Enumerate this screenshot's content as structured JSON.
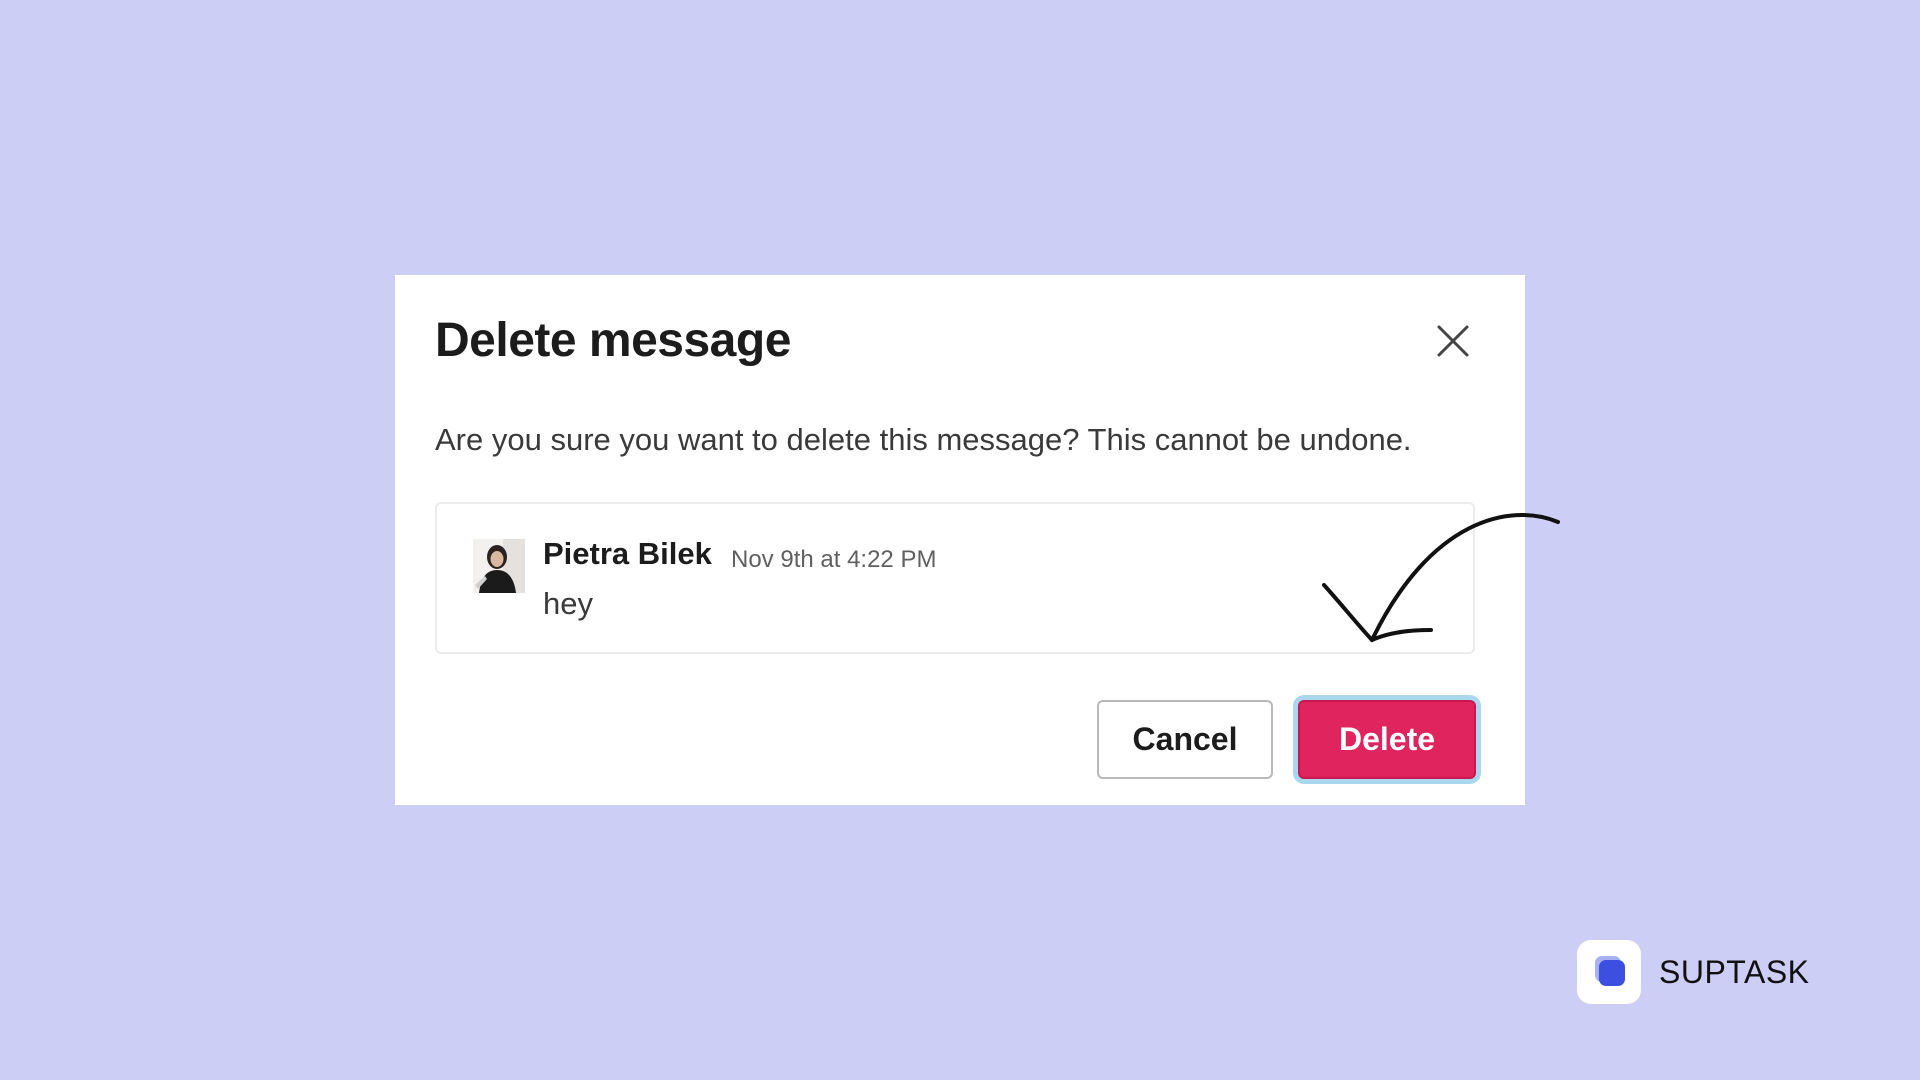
{
  "dialog": {
    "title": "Delete message",
    "description": "Are you sure you want to delete this message? This cannot be undone.",
    "close_icon": "close-icon",
    "message": {
      "author": "Pietra Bilek",
      "timestamp": "Nov 9th at 4:22 PM",
      "text": "hey"
    },
    "cancel_label": "Cancel",
    "delete_label": "Delete"
  },
  "annotation": {
    "arrow_icon": "hand-drawn-arrow-icon"
  },
  "brand": {
    "name": "SUPTASK",
    "logo_icon": "suptask-logo-icon"
  },
  "colors": {
    "background": "#cdcef6",
    "delete_button": "#e0245e",
    "focus_ring": "#a9d8ee",
    "brand_accent": "#3d4fe0"
  }
}
